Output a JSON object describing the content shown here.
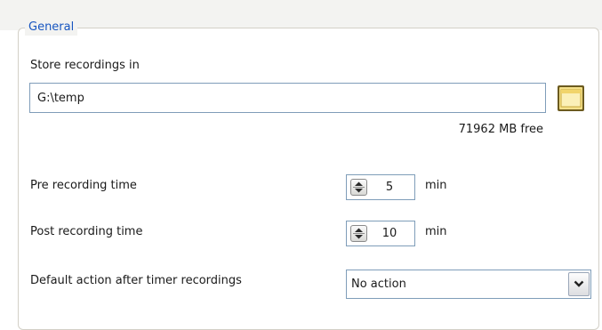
{
  "group": {
    "title": "General"
  },
  "storage": {
    "label": "Store recordings in",
    "path_value": "G:\\temp",
    "browse_icon": "folder-icon",
    "free_space": "71962 MB free"
  },
  "pre_recording": {
    "label": "Pre recording time",
    "value": "5",
    "unit": "min"
  },
  "post_recording": {
    "label": "Post recording time",
    "value": "10",
    "unit": "min"
  },
  "default_action": {
    "label": "Default action after timer recordings",
    "selected": "No action"
  },
  "colors": {
    "group_title": "#1755c0",
    "field_border": "#7f9db9",
    "folder_fill": "#f4e08a"
  }
}
